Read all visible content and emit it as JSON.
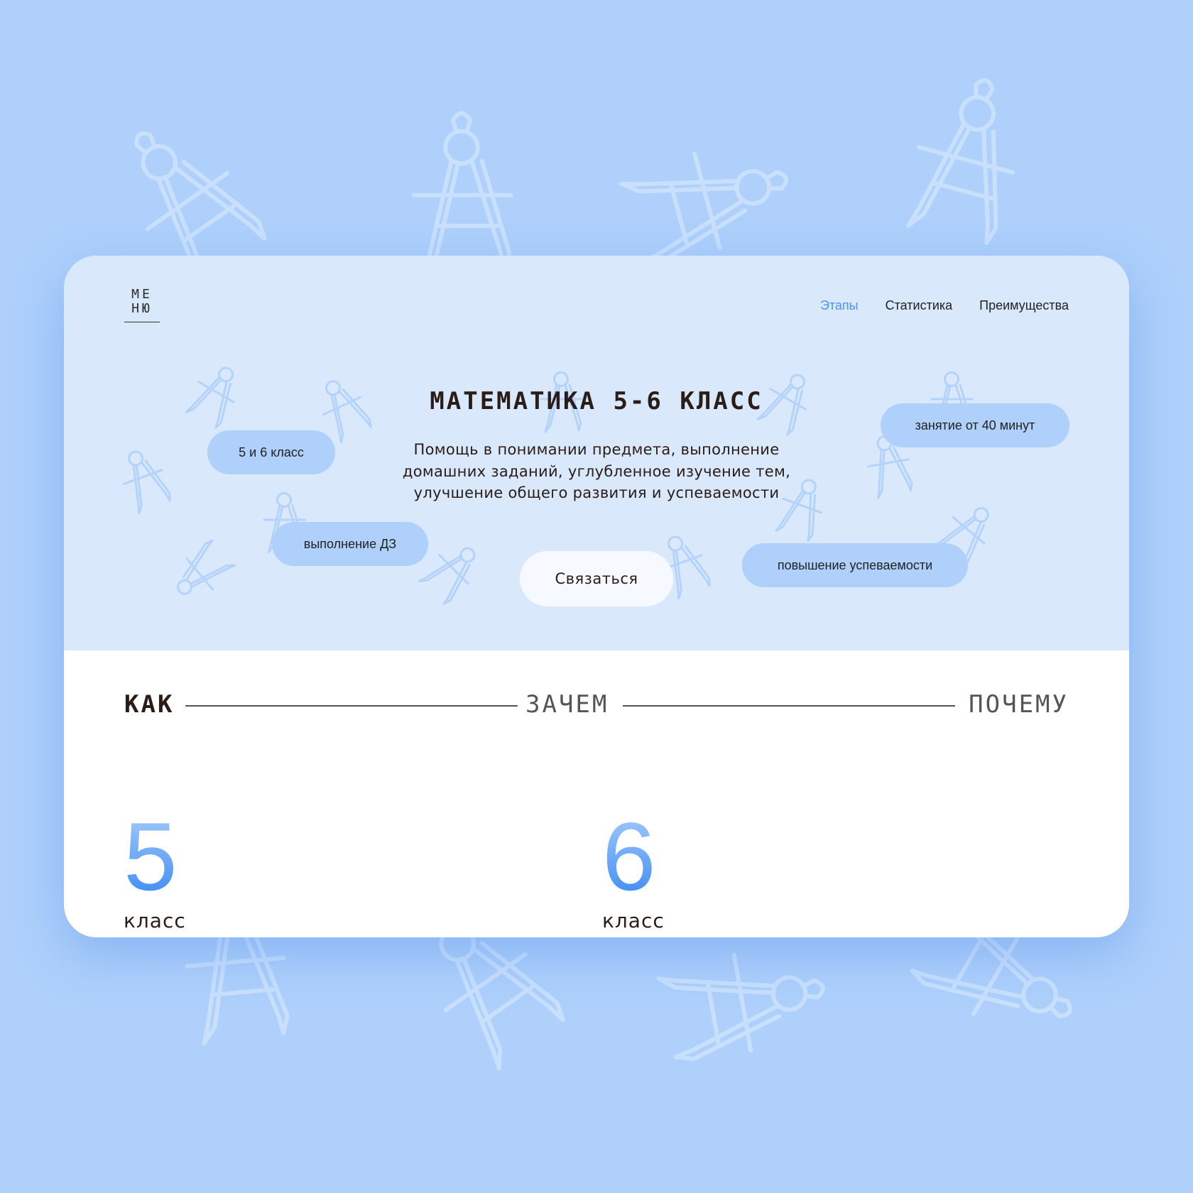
{
  "colors": {
    "background": "#aed0fb",
    "hero_background": "#d9e8fb",
    "accent": "#4c94ef",
    "pill": "#aed0fb",
    "text": "#2a1c16"
  },
  "icons": [
    "compass-icon"
  ],
  "menu": {
    "line1": "МЕ",
    "line2": "НЮ"
  },
  "nav": {
    "items": [
      {
        "label": "Этапы",
        "active": true
      },
      {
        "label": "Статистика",
        "active": false
      },
      {
        "label": "Преимущества",
        "active": false
      }
    ]
  },
  "hero": {
    "title": "МАТЕМАТИКА 5-6 КЛАСС",
    "description": "Помощь в понимании предмета, выполнение домашних заданий, углубленное изучение тем, улучшение общего развития и успеваемости",
    "cta_label": "Связаться",
    "pills": [
      "5 и 6 класс",
      "выполнение ДЗ",
      "занятие от 40 минут",
      "повышение успеваемости"
    ]
  },
  "stages": {
    "items": [
      "КАК",
      "ЗАЧЕМ",
      "ПОЧЕМУ"
    ]
  },
  "grades": [
    {
      "number": "5",
      "label": "класс"
    },
    {
      "number": "6",
      "label": "класс"
    }
  ]
}
